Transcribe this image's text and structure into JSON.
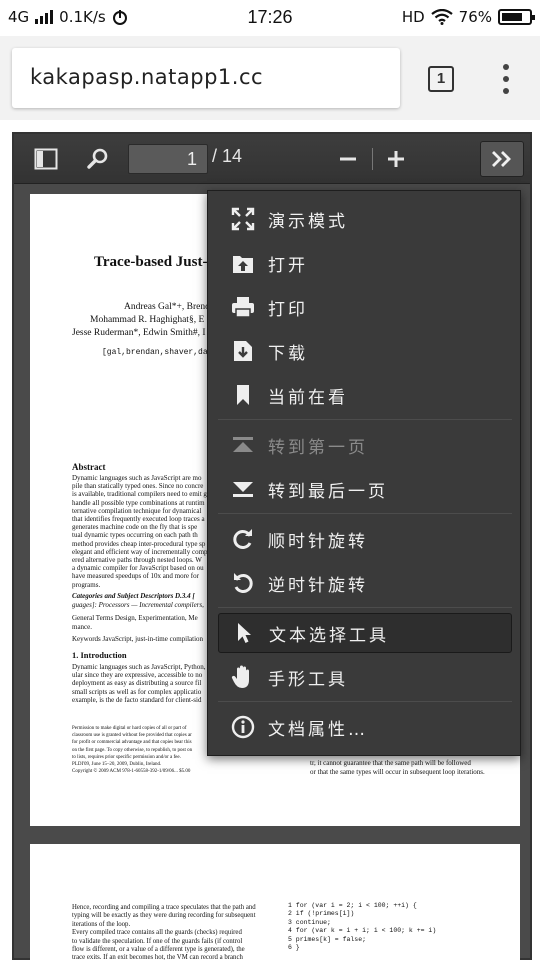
{
  "status_bar": {
    "network": "4G",
    "speed": "0.1K/s",
    "time": "17:26",
    "hd": "HD",
    "battery": "76%",
    "battery_level": 0.76
  },
  "browser": {
    "url": "kakapasp.natapp1.cc",
    "tab_count": "1"
  },
  "viewer": {
    "current_page": "1",
    "total_pages": "/ 14"
  },
  "menu": {
    "items": [
      {
        "label": "演示模式",
        "icon": "fullscreen-icon"
      },
      {
        "label": "打开",
        "icon": "open-file-icon"
      },
      {
        "label": "打印",
        "icon": "printer-icon"
      },
      {
        "label": "下载",
        "icon": "download-icon"
      },
      {
        "label": "当前在看",
        "icon": "bookmark-icon"
      },
      {
        "label": "转到第一页",
        "icon": "first-page-icon",
        "disabled": true
      },
      {
        "label": "转到最后一页",
        "icon": "last-page-icon"
      },
      {
        "label": "顺时针旋转",
        "icon": "rotate-cw-icon"
      },
      {
        "label": "逆时针旋转",
        "icon": "rotate-ccw-icon"
      },
      {
        "label": "文本选择工具",
        "icon": "cursor-icon",
        "active": true
      },
      {
        "label": "手形工具",
        "icon": "hand-icon"
      },
      {
        "label": "文档属性…",
        "icon": "info-icon"
      }
    ]
  },
  "document": {
    "page1": {
      "title": "Trace-based Just-i",
      "authors_1": "Andreas Gal*+, Brenda",
      "authors_2": "Mohammad R. Haghighat§, E",
      "authors_3": "Jesse Ruderman*, Edwin Smith#, I",
      "emails": "[gal,brendan,shaver,danderso",
      "abstract_heading": "Abstract",
      "abstract_lines": [
        "Dynamic languages such as JavaScript are mo",
        "pile than statically typed ones. Since no concre",
        "is available, traditional compilers need to emit g",
        "handle all possible type combinations at runtim",
        "ternative compilation technique for dynamical",
        "that identifies frequently executed loop traces a",
        "generates machine code on the fly that is spe",
        "tual dynamic types occurring on each path th",
        "method provides cheap inter-procedural type sp",
        "elegant and efficient way of incrementally comp",
        "ered alternative paths through nested loops. W",
        "a dynamic compiler for JavaScript based on ou",
        "have measured speedups of 10x and more for",
        "programs."
      ],
      "categories": "Categories and Subject Descriptors   D.3.4 [",
      "categories_2": "guages]: Processors — Incremental compilers, ",
      "general_terms": "General Terms   Design, Experimentation, Me",
      "general_terms_2": "mance.",
      "keywords": "Keywords    JavaScript, just-in-time compilation",
      "intro_heading": "1.   Introduction",
      "intro_lines": [
        "Dynamic languages such as JavaScript, Python,",
        "ular since they are expressive, accessible to no",
        "deployment as easy as distributing a source fil",
        "small scripts as well as for complex applicatio",
        "example, is the de facto standard for client-sid"
      ],
      "footnote_lines": [
        "Permission to make digital or hard copies of all or part of",
        "classroom use is granted without fee provided that copies ar",
        "for profit or commercial advantage and that copies bear this",
        "on the first page. To copy otherwise, to republish, to post on",
        "to lists, requires prior specific permission and/or a fee.",
        "PLDI'09,   June 15–20, 2009, Dublin, Ireland.",
        "Copyright © 2009 ACM 978-1-60558-392-1/09/06... $5.00"
      ],
      "right_col_1": "tr, it cannot guarantee that the same path will be followed",
      "right_col_2": "or that the same types will occur in subsequent loop iterations."
    },
    "page2": {
      "left_lines": [
        "Hence, recording and compiling a trace speculates that the path and",
        "typing will be exactly as they were during recording for subsequent",
        "iterations of the loop.",
        "    Every compiled trace contains all the guards (checks) required",
        "to validate the speculation. If one of the guards fails (if control",
        "flow is different, or a value of a different type is generated), the",
        "trace exits. If an exit becomes hot, the VM can record a branch"
      ],
      "code_lines": [
        "1 for (var i = 2; i < 100; ++i) {",
        "2   if (!primes[i])",
        "3     continue;",
        "4   for (var k = i + i; i < 100; k += i)",
        "5     primes[k] = false;",
        "6 }"
      ]
    }
  }
}
